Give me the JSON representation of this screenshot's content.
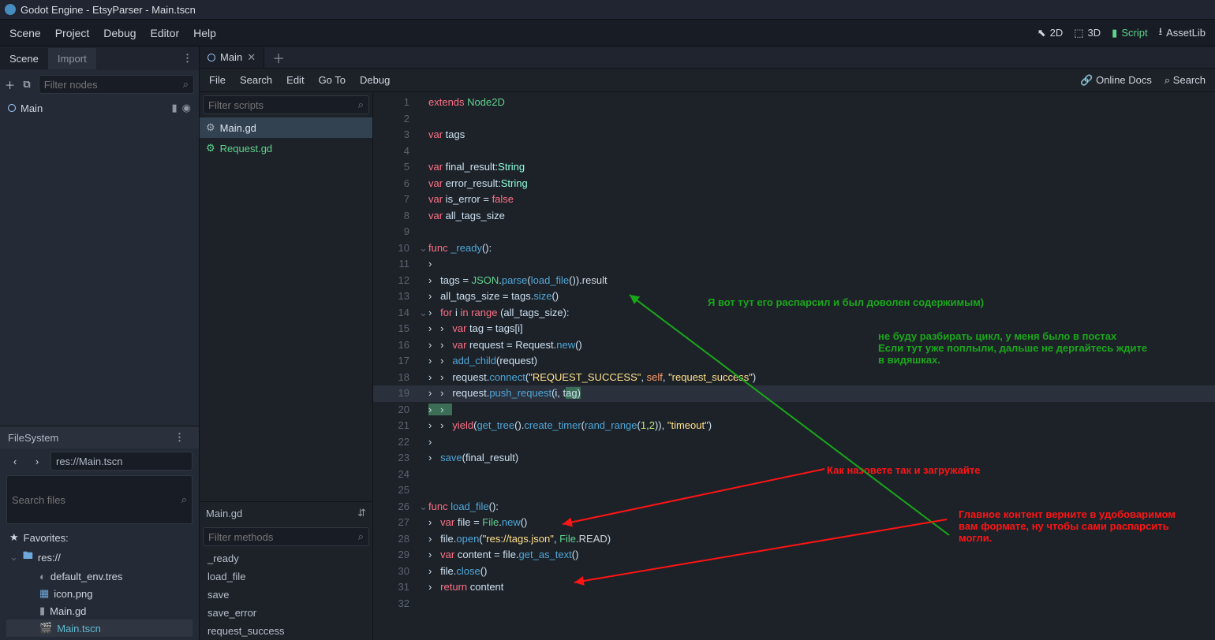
{
  "title": "Godot Engine - EtsyParser - Main.tscn",
  "menubar": [
    "Scene",
    "Project",
    "Debug",
    "Editor",
    "Help"
  ],
  "workspace": {
    "d2": "2D",
    "d3": "3D",
    "script": "Script",
    "assetlib": "AssetLib"
  },
  "scene_panel": {
    "tab_scene": "Scene",
    "tab_import": "Import",
    "filter_ph": "Filter nodes",
    "root": "Main"
  },
  "scriptbar": {
    "file": "File",
    "search": "Search",
    "edit": "Edit",
    "goto": "Go To",
    "debug": "Debug",
    "online": "Online Docs",
    "searchhelp": "Search"
  },
  "doc_tab": "Main",
  "scriptlist": {
    "filter_ph": "Filter scripts",
    "items": [
      "Main.gd",
      "Request.gd"
    ],
    "crumb": "Main.gd",
    "methods_ph": "Filter methods",
    "methods": [
      "_ready",
      "load_file",
      "save",
      "save_error",
      "request_success"
    ]
  },
  "fs": {
    "title": "FileSystem",
    "path": "res://Main.tscn",
    "search_ph": "Search files",
    "fav": "Favorites:",
    "root": "res://",
    "files": [
      "default_env.tres",
      "icon.png",
      "Main.gd",
      "Main.tscn"
    ]
  },
  "code": [
    {
      "n": 1,
      "f": "",
      "t": [
        [
          "kw",
          "extends"
        ],
        [
          "",
          " "
        ],
        [
          "cls",
          "Node2D"
        ]
      ]
    },
    {
      "n": 2,
      "f": "",
      "t": [
        [
          "",
          ""
        ]
      ]
    },
    {
      "n": 3,
      "f": "",
      "t": [
        [
          "kw",
          "var"
        ],
        [
          "",
          " tags"
        ]
      ]
    },
    {
      "n": 4,
      "f": "",
      "t": [
        [
          "",
          ""
        ]
      ]
    },
    {
      "n": 5,
      "f": "",
      "t": [
        [
          "kw",
          "var"
        ],
        [
          "",
          " final_result:"
        ],
        [
          "type",
          "String"
        ]
      ]
    },
    {
      "n": 6,
      "f": "",
      "t": [
        [
          "kw",
          "var"
        ],
        [
          "",
          " error_result:"
        ],
        [
          "type",
          "String"
        ]
      ]
    },
    {
      "n": 7,
      "f": "",
      "t": [
        [
          "kw",
          "var"
        ],
        [
          "",
          " is_error = "
        ],
        [
          "kw",
          "false"
        ]
      ]
    },
    {
      "n": 8,
      "f": "",
      "t": [
        [
          "kw",
          "var"
        ],
        [
          "",
          " all_tags_size"
        ]
      ]
    },
    {
      "n": 9,
      "f": "",
      "t": [
        [
          "",
          ""
        ]
      ]
    },
    {
      "n": 10,
      "f": "⌄",
      "t": [
        [
          "kw",
          "func"
        ],
        [
          "",
          " "
        ],
        [
          "fn",
          "_ready"
        ],
        [
          "",
          "():"
        ]
      ]
    },
    {
      "n": 11,
      "f": "",
      "t": [
        [
          "",
          "›   "
        ]
      ]
    },
    {
      "n": 12,
      "f": "",
      "t": [
        [
          "",
          "›   tags = "
        ],
        [
          "cls",
          "JSON"
        ],
        [
          "",
          "."
        ],
        [
          "fn",
          "parse"
        ],
        [
          "",
          "("
        ],
        [
          "fn",
          "load_file"
        ],
        [
          "",
          "())."
        ],
        [
          "const",
          "result"
        ]
      ]
    },
    {
      "n": 13,
      "f": "",
      "t": [
        [
          "",
          "›   all_tags_size = tags."
        ],
        [
          "fn",
          "size"
        ],
        [
          "",
          "()"
        ]
      ]
    },
    {
      "n": 14,
      "f": "⌄",
      "t": [
        [
          "",
          "›   "
        ],
        [
          "kw",
          "for"
        ],
        [
          "",
          " i "
        ],
        [
          "kw",
          "in"
        ],
        [
          "",
          " "
        ],
        [
          "kw",
          "range"
        ],
        [
          "",
          " (all_tags_size):"
        ]
      ]
    },
    {
      "n": 15,
      "f": "",
      "t": [
        [
          "",
          "›   ›   "
        ],
        [
          "kw",
          "var"
        ],
        [
          "",
          " tag = tags[i]"
        ]
      ]
    },
    {
      "n": 16,
      "f": "",
      "t": [
        [
          "",
          "›   ›   "
        ],
        [
          "kw",
          "var"
        ],
        [
          "",
          " request = Request."
        ],
        [
          "fn",
          "new"
        ],
        [
          "",
          "()"
        ]
      ]
    },
    {
      "n": 17,
      "f": "",
      "t": [
        [
          "",
          "›   ›   "
        ],
        [
          "fn",
          "add_child"
        ],
        [
          "",
          "(request)"
        ]
      ]
    },
    {
      "n": 18,
      "f": "",
      "t": [
        [
          "",
          "›   ›   request."
        ],
        [
          "fn",
          "connect"
        ],
        [
          "",
          "("
        ],
        [
          "str",
          "\"REQUEST_SUCCESS\""
        ],
        [
          "",
          ", "
        ],
        [
          "self",
          "self"
        ],
        [
          "",
          ", "
        ],
        [
          "str",
          "\"request_success\""
        ],
        [
          "",
          ")"
        ]
      ]
    },
    {
      "n": 19,
      "f": "",
      "cl": true,
      "t": [
        [
          "",
          "›   ›   request."
        ],
        [
          "fn",
          "push_request"
        ],
        [
          "",
          "(i, t"
        ],
        [
          "hl",
          "ag)"
        ]
      ]
    },
    {
      "n": 20,
      "f": "",
      "t": [
        [
          "hl2",
          "›   ›   "
        ]
      ]
    },
    {
      "n": 21,
      "f": "",
      "t": [
        [
          "",
          "›   ›   "
        ],
        [
          "kw",
          "yield"
        ],
        [
          "",
          "("
        ],
        [
          "fn",
          "get_tree"
        ],
        [
          "",
          "()."
        ],
        [
          "fn",
          "create_timer"
        ],
        [
          "",
          "("
        ],
        [
          "fn",
          "rand_range"
        ],
        [
          "",
          "("
        ],
        [
          "num",
          "1"
        ],
        [
          "",
          ","
        ],
        [
          "num",
          "2"
        ],
        [
          "",
          ")), "
        ],
        [
          "str",
          "\"timeout\""
        ],
        [
          "",
          ")"
        ]
      ]
    },
    {
      "n": 22,
      "f": "",
      "t": [
        [
          "",
          "›   "
        ]
      ]
    },
    {
      "n": 23,
      "f": "",
      "t": [
        [
          "",
          "›   "
        ],
        [
          "fn",
          "save"
        ],
        [
          "",
          "(final_result)"
        ]
      ]
    },
    {
      "n": 24,
      "f": "",
      "t": [
        [
          "",
          ""
        ]
      ]
    },
    {
      "n": 25,
      "f": "",
      "t": [
        [
          "",
          ""
        ]
      ]
    },
    {
      "n": 26,
      "f": "⌄",
      "t": [
        [
          "kw",
          "func"
        ],
        [
          "",
          " "
        ],
        [
          "fn",
          "load_file"
        ],
        [
          "",
          "():"
        ]
      ]
    },
    {
      "n": 27,
      "f": "",
      "t": [
        [
          "",
          "›   "
        ],
        [
          "kw",
          "var"
        ],
        [
          "",
          " file = "
        ],
        [
          "cls",
          "File"
        ],
        [
          "",
          "."
        ],
        [
          "fn",
          "new"
        ],
        [
          "",
          "()"
        ]
      ]
    },
    {
      "n": 28,
      "f": "",
      "t": [
        [
          "",
          "›   file."
        ],
        [
          "fn",
          "open"
        ],
        [
          "",
          "("
        ],
        [
          "str",
          "\"res://tags.json\""
        ],
        [
          "",
          ", "
        ],
        [
          "cls",
          "File"
        ],
        [
          "",
          "."
        ],
        [
          "const",
          "READ"
        ],
        [
          "",
          ")"
        ]
      ]
    },
    {
      "n": 29,
      "f": "",
      "t": [
        [
          "",
          "›   "
        ],
        [
          "kw",
          "var"
        ],
        [
          "",
          " content = file."
        ],
        [
          "fn",
          "get_as_text"
        ],
        [
          "",
          "()"
        ]
      ]
    },
    {
      "n": 30,
      "f": "",
      "t": [
        [
          "",
          "›   file."
        ],
        [
          "fn",
          "close"
        ],
        [
          "",
          "()"
        ]
      ]
    },
    {
      "n": 31,
      "f": "",
      "t": [
        [
          "",
          "›   "
        ],
        [
          "kw",
          "return"
        ],
        [
          "",
          " content"
        ]
      ]
    },
    {
      "n": 32,
      "f": "",
      "t": [
        [
          "",
          ""
        ]
      ]
    }
  ],
  "annot": {
    "a1": "Я вот тут его распарсил и был доволен содержимым)",
    "a2a": "не буду разбирать цикл, у меня было в постах",
    "a2b": "Если тут уже поплыли, дальше не дергайтесь ждите",
    "a2c": "в видяшках.",
    "a3": "Как назовете так и загружайте",
    "a4a": "Главное контент верните в удобоваримом",
    "a4b": "вам формате, ну чтобы сами распарсить",
    "a4c": "могли."
  }
}
